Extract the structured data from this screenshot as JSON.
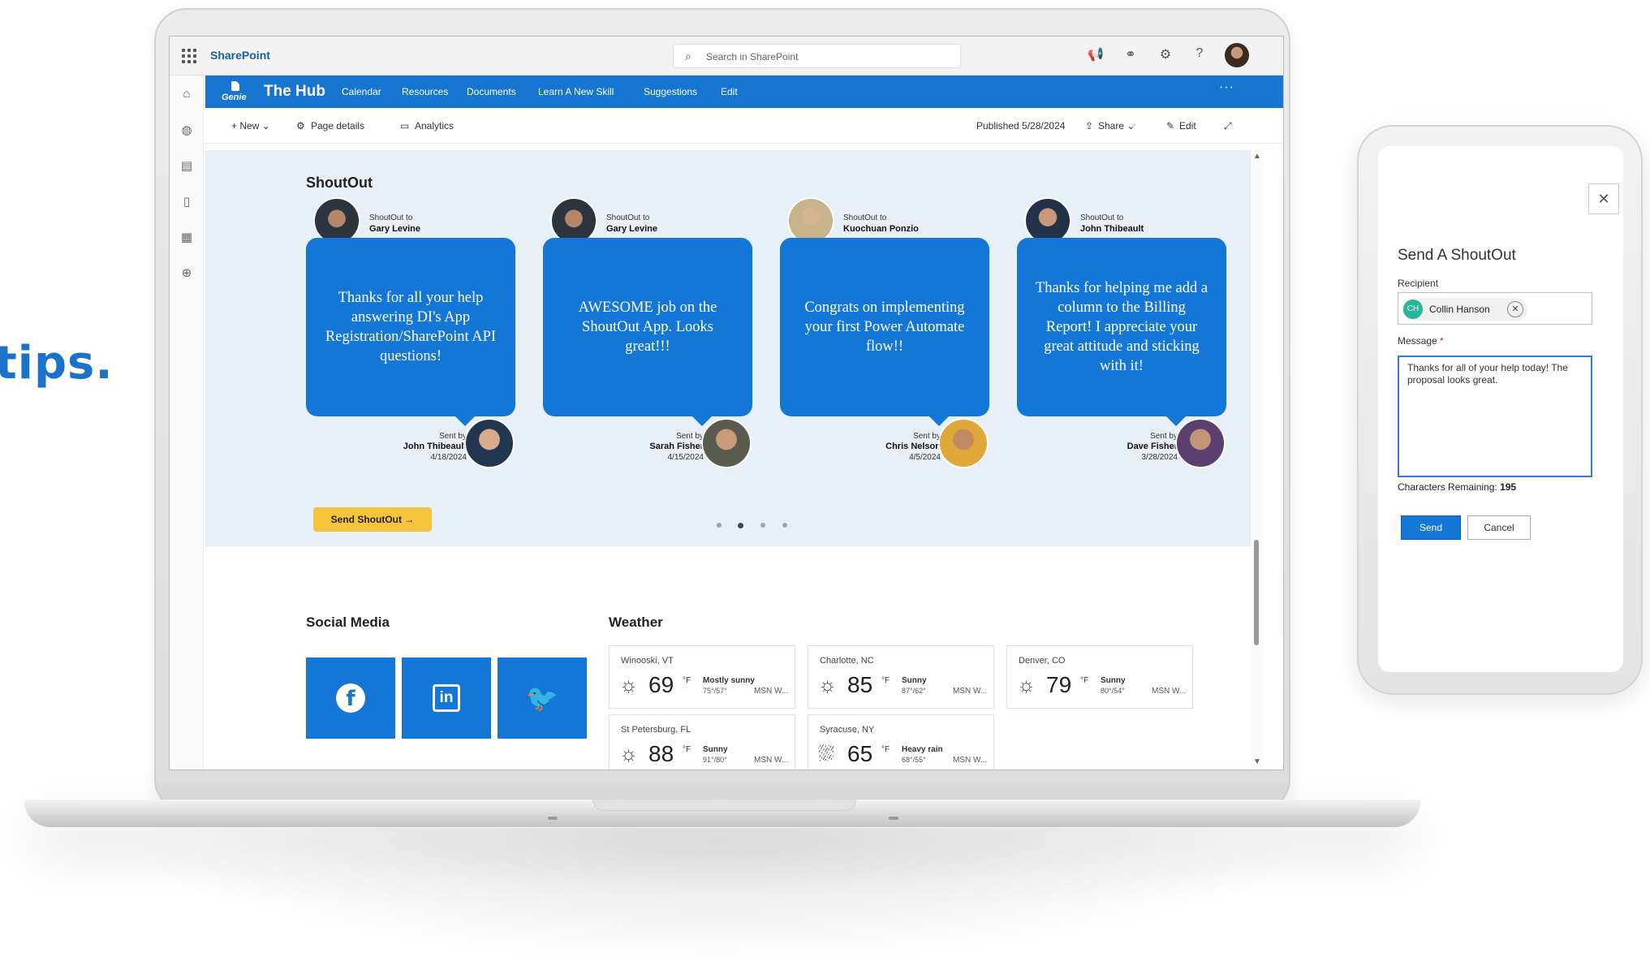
{
  "background_text": "tips.",
  "suite": {
    "app_name": "SharePoint",
    "search_placeholder": "Search in SharePoint"
  },
  "hubnav": {
    "logo_text": "Genie",
    "title": "The Hub",
    "links": [
      "Calendar",
      "Resources",
      "Documents",
      "Learn A New Skill",
      "Suggestions",
      "Edit"
    ],
    "more": "···"
  },
  "cmdbar": {
    "new_label": "+ New ⌄",
    "page_details": "Page details",
    "analytics": "Analytics",
    "published": "Published 5/28/2024",
    "share": "Share ⌄",
    "edit": "Edit"
  },
  "shoutout": {
    "title": "ShoutOut",
    "to_label": "ShoutOut to",
    "sent_label": "Sent by",
    "cards": [
      {
        "to": "Gary Levine",
        "message": "Thanks for all your help answering DI's App Registration/SharePoint API questions!",
        "from": "John Thibeault",
        "date": "4/18/2024"
      },
      {
        "to": "Gary Levine",
        "message": "AWESOME job on the ShoutOut App. Looks great!!!",
        "from": "Sarah Fisher",
        "date": "4/15/2024"
      },
      {
        "to": "Kuochuan Ponzio",
        "message": "Congrats on implementing your first Power Automate flow!!",
        "from": "Chris Nelson",
        "date": "4/5/2024"
      },
      {
        "to": "John Thibeault",
        "message": "Thanks for helping me add a column to the Billing Report! I appreciate your great attitude and sticking with it!",
        "from": "Dave Fisher",
        "date": "3/28/2024"
      }
    ],
    "send_button": "Send ShoutOut →",
    "carousel_active": 2,
    "carousel_count": 4
  },
  "social": {
    "title": "Social Media",
    "tiles": [
      "f",
      "in",
      "🐦"
    ]
  },
  "weather": {
    "title": "Weather",
    "items": [
      {
        "city": "Winooski, VT",
        "icon": "☼",
        "temp": "69",
        "unit": "°F",
        "cond": "Mostly sunny",
        "range": "75°/57°",
        "src": "MSN W..."
      },
      {
        "city": "Charlotte, NC",
        "icon": "☼",
        "temp": "85",
        "unit": "°F",
        "cond": "Sunny",
        "range": "87°/62°",
        "src": "MSN W..."
      },
      {
        "city": "Denver, CO",
        "icon": "☼",
        "temp": "79",
        "unit": "°F",
        "cond": "Sunny",
        "range": "80°/54°",
        "src": "MSN W..."
      },
      {
        "city": "St Petersburg, FL",
        "icon": "☼",
        "temp": "88",
        "unit": "°F",
        "cond": "Sunny",
        "range": "91°/80°",
        "src": "MSN W..."
      },
      {
        "city": "Syracuse, NY",
        "icon": "⛆",
        "temp": "65",
        "unit": "°F",
        "cond": "Heavy rain",
        "range": "68°/55°",
        "src": "MSN W..."
      }
    ]
  },
  "panel": {
    "title": "Send A ShoutOut",
    "recipient_label": "Recipient",
    "recipient_initials": "CH",
    "recipient_name": "Collin Hanson",
    "message_label": "Message",
    "message_required": "*",
    "message_value": "Thanks for all of your help today! The proposal looks great.",
    "chars_label": "Characters Remaining:",
    "chars_value": "195",
    "send": "Send",
    "cancel": "Cancel"
  }
}
